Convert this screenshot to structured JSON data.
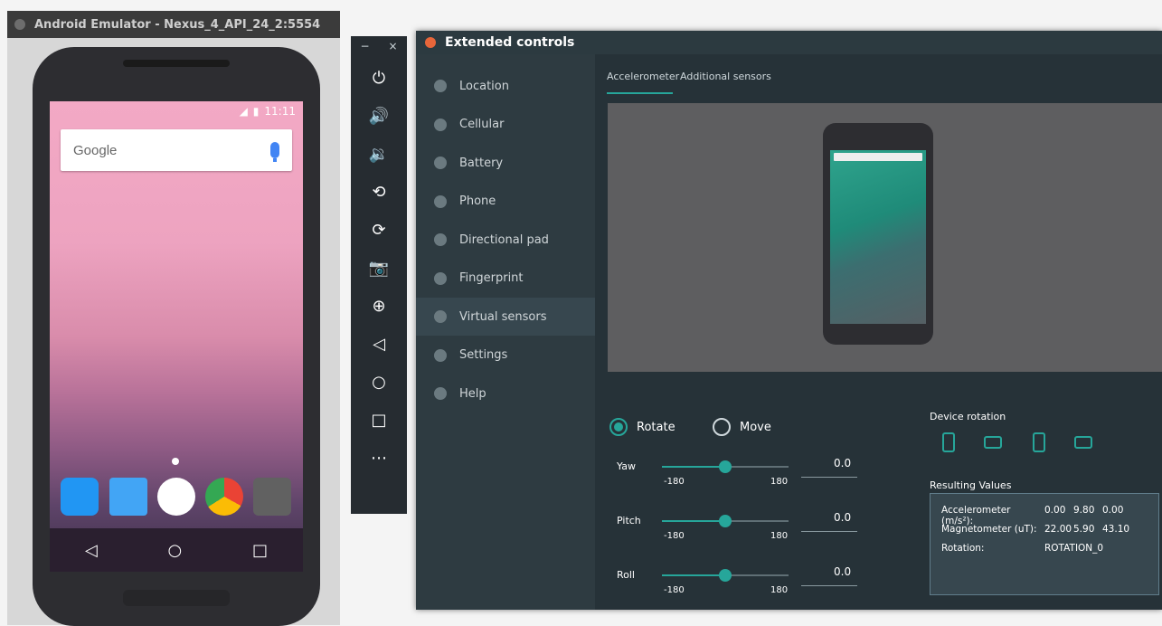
{
  "emulator": {
    "title": "Android Emulator - Nexus_4_API_24_2:5554",
    "status_time": "11:11",
    "google_label": "Google",
    "nav_buttons": [
      "◁",
      "○",
      "□"
    ]
  },
  "toolbar": {
    "window_buttons": [
      "−",
      "×"
    ],
    "buttons": [
      {
        "name": "power-icon",
        "glyph": "⏻"
      },
      {
        "name": "volume-up-icon",
        "glyph": "🔊"
      },
      {
        "name": "volume-down-icon",
        "glyph": "🔉"
      },
      {
        "name": "rotate-left-icon",
        "glyph": "⟲"
      },
      {
        "name": "rotate-right-icon",
        "glyph": "⟳"
      },
      {
        "name": "camera-icon",
        "glyph": "📷"
      },
      {
        "name": "zoom-icon",
        "glyph": "⊕"
      },
      {
        "name": "back-icon",
        "glyph": "◁"
      },
      {
        "name": "home-icon",
        "glyph": "○"
      },
      {
        "name": "overview-icon",
        "glyph": "□"
      },
      {
        "name": "more-icon",
        "glyph": "⋯"
      }
    ]
  },
  "extended": {
    "title": "Extended controls",
    "nav": [
      "Location",
      "Cellular",
      "Battery",
      "Phone",
      "Directional pad",
      "Fingerprint",
      "Virtual sensors",
      "Settings",
      "Help"
    ],
    "tabs": [
      "Accelerometer",
      "Additional sensors"
    ],
    "radio_rotate": "Rotate",
    "radio_move": "Move",
    "sliders": [
      {
        "label": "Yaw",
        "min": "-180",
        "max": "180",
        "value": "0.0",
        "fraction": 0.5
      },
      {
        "label": "Pitch",
        "min": "-180",
        "max": "180",
        "value": "0.0",
        "fraction": 0.5
      },
      {
        "label": "Roll",
        "min": "-180",
        "max": "180",
        "value": "0.0",
        "fraction": 0.5
      }
    ],
    "device_rotation_title": "Device rotation",
    "resulting_values_title": "Resulting Values",
    "results": [
      {
        "label": "Accelerometer (m/s²):",
        "values": [
          "0.00",
          "9.80",
          "0.00"
        ]
      },
      {
        "label": "Magnetometer (uT):",
        "values": [
          "22.00",
          "5.90",
          "43.10"
        ]
      },
      {
        "label": "Rotation:",
        "values": [
          "ROTATION_0"
        ]
      }
    ]
  }
}
